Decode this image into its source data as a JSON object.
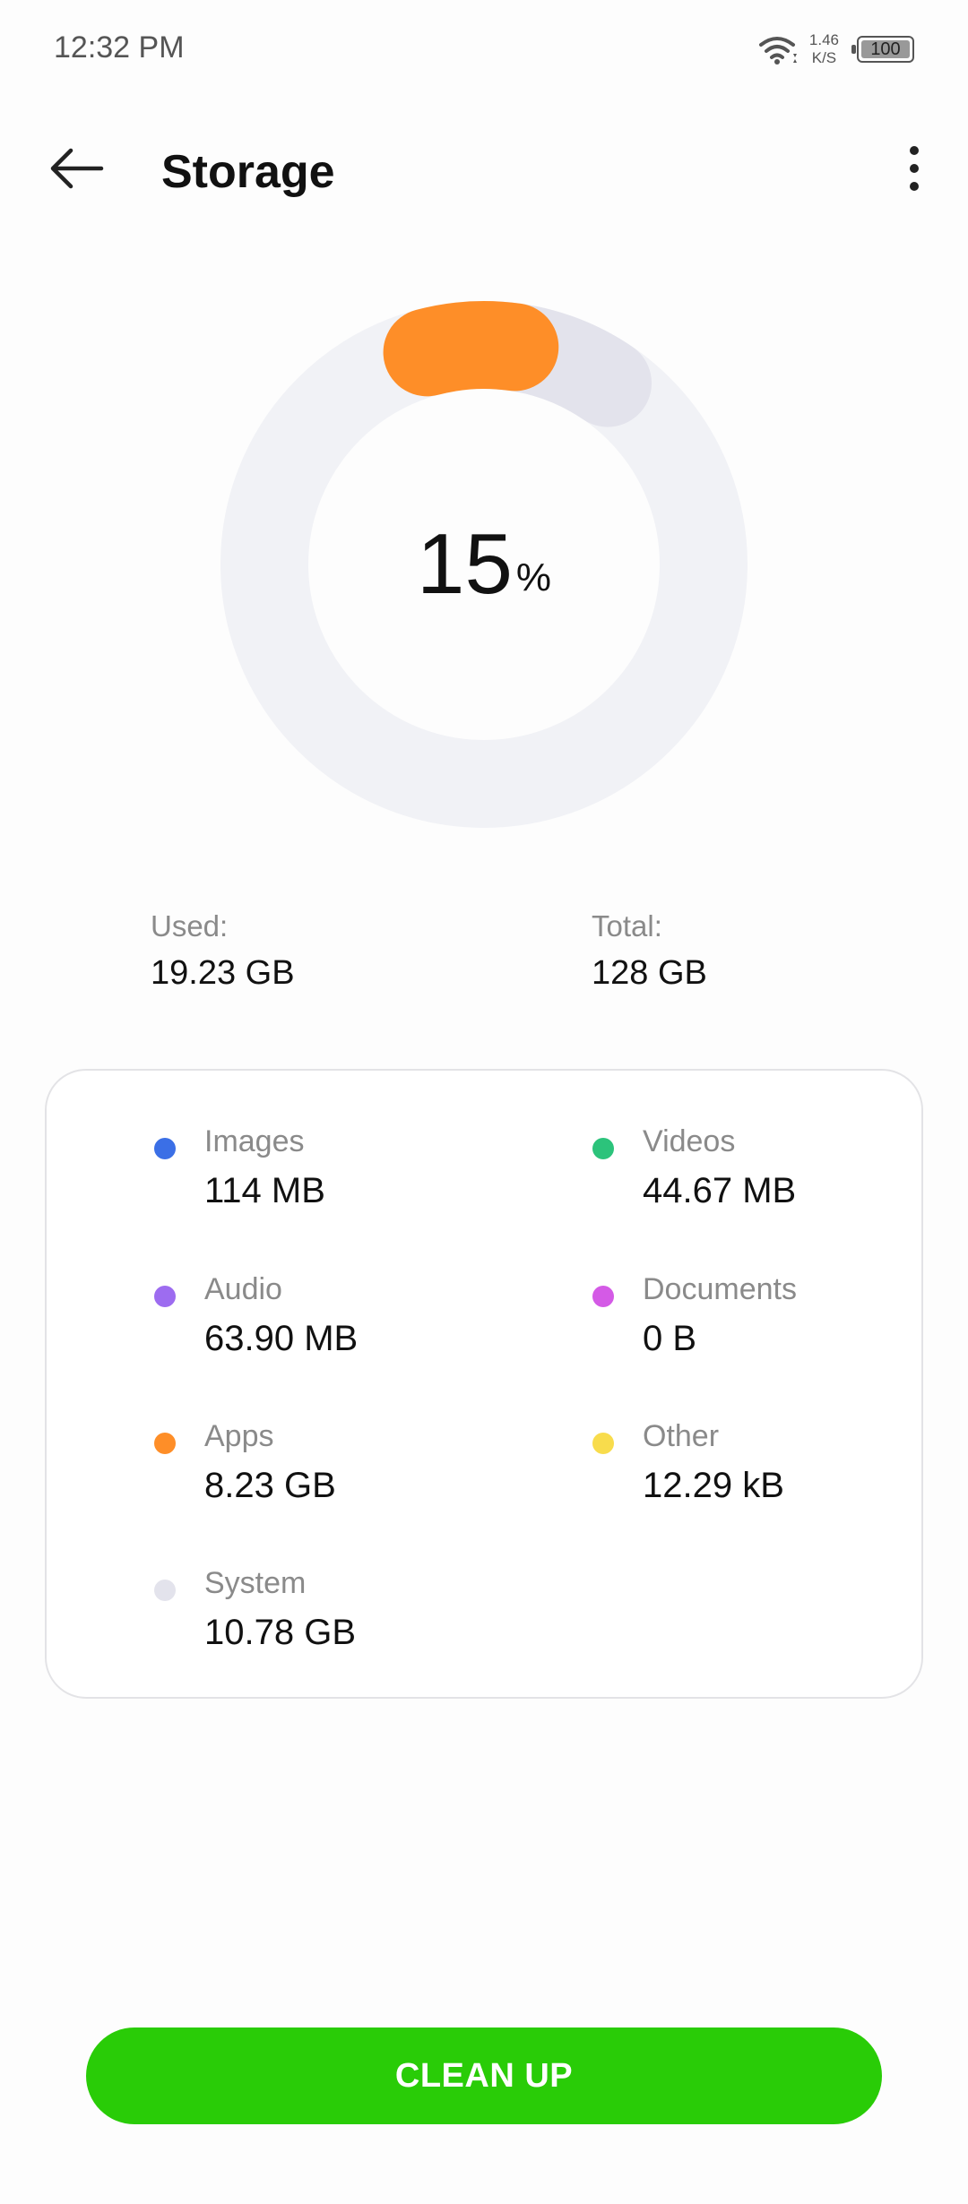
{
  "status_bar": {
    "time": "12:32 PM",
    "net_speed_value": "1.46",
    "net_speed_unit": "K/S",
    "battery_level": "100",
    "icons": [
      "wifi-icon",
      "battery-icon"
    ]
  },
  "app_bar": {
    "title": "Storage",
    "back_icon": "back-arrow-icon",
    "more_icon": "more-vertical-icon"
  },
  "ring": {
    "percent_number": "15",
    "percent_sign": "%",
    "apps_fraction": 0.064,
    "system_fraction": 0.084,
    "colors": {
      "track": "#f1f2f6",
      "apps": "#fe8e28",
      "system": "#e3e3ec"
    }
  },
  "usage": {
    "used_label": "Used:",
    "used_value": "19.23 GB",
    "total_label": "Total:",
    "total_value": "128 GB"
  },
  "categories": [
    {
      "label": "Images",
      "value": "114 MB",
      "color": "#3b6fe6"
    },
    {
      "label": "Videos",
      "value": "44.67 MB",
      "color": "#2cc37b"
    },
    {
      "label": "Audio",
      "value": "63.90 MB",
      "color": "#9d6cf0"
    },
    {
      "label": "Documents",
      "value": "0 B",
      "color": "#d45ae6"
    },
    {
      "label": "Apps",
      "value": "8.23 GB",
      "color": "#fe8e28"
    },
    {
      "label": "Other",
      "value": "12.29 kB",
      "color": "#f8dc4c"
    },
    {
      "label": "System",
      "value": "10.78 GB",
      "color": "#e3e3ec"
    }
  ],
  "cleanup_button": {
    "label": "CLEAN UP",
    "color": "#29cc07"
  }
}
